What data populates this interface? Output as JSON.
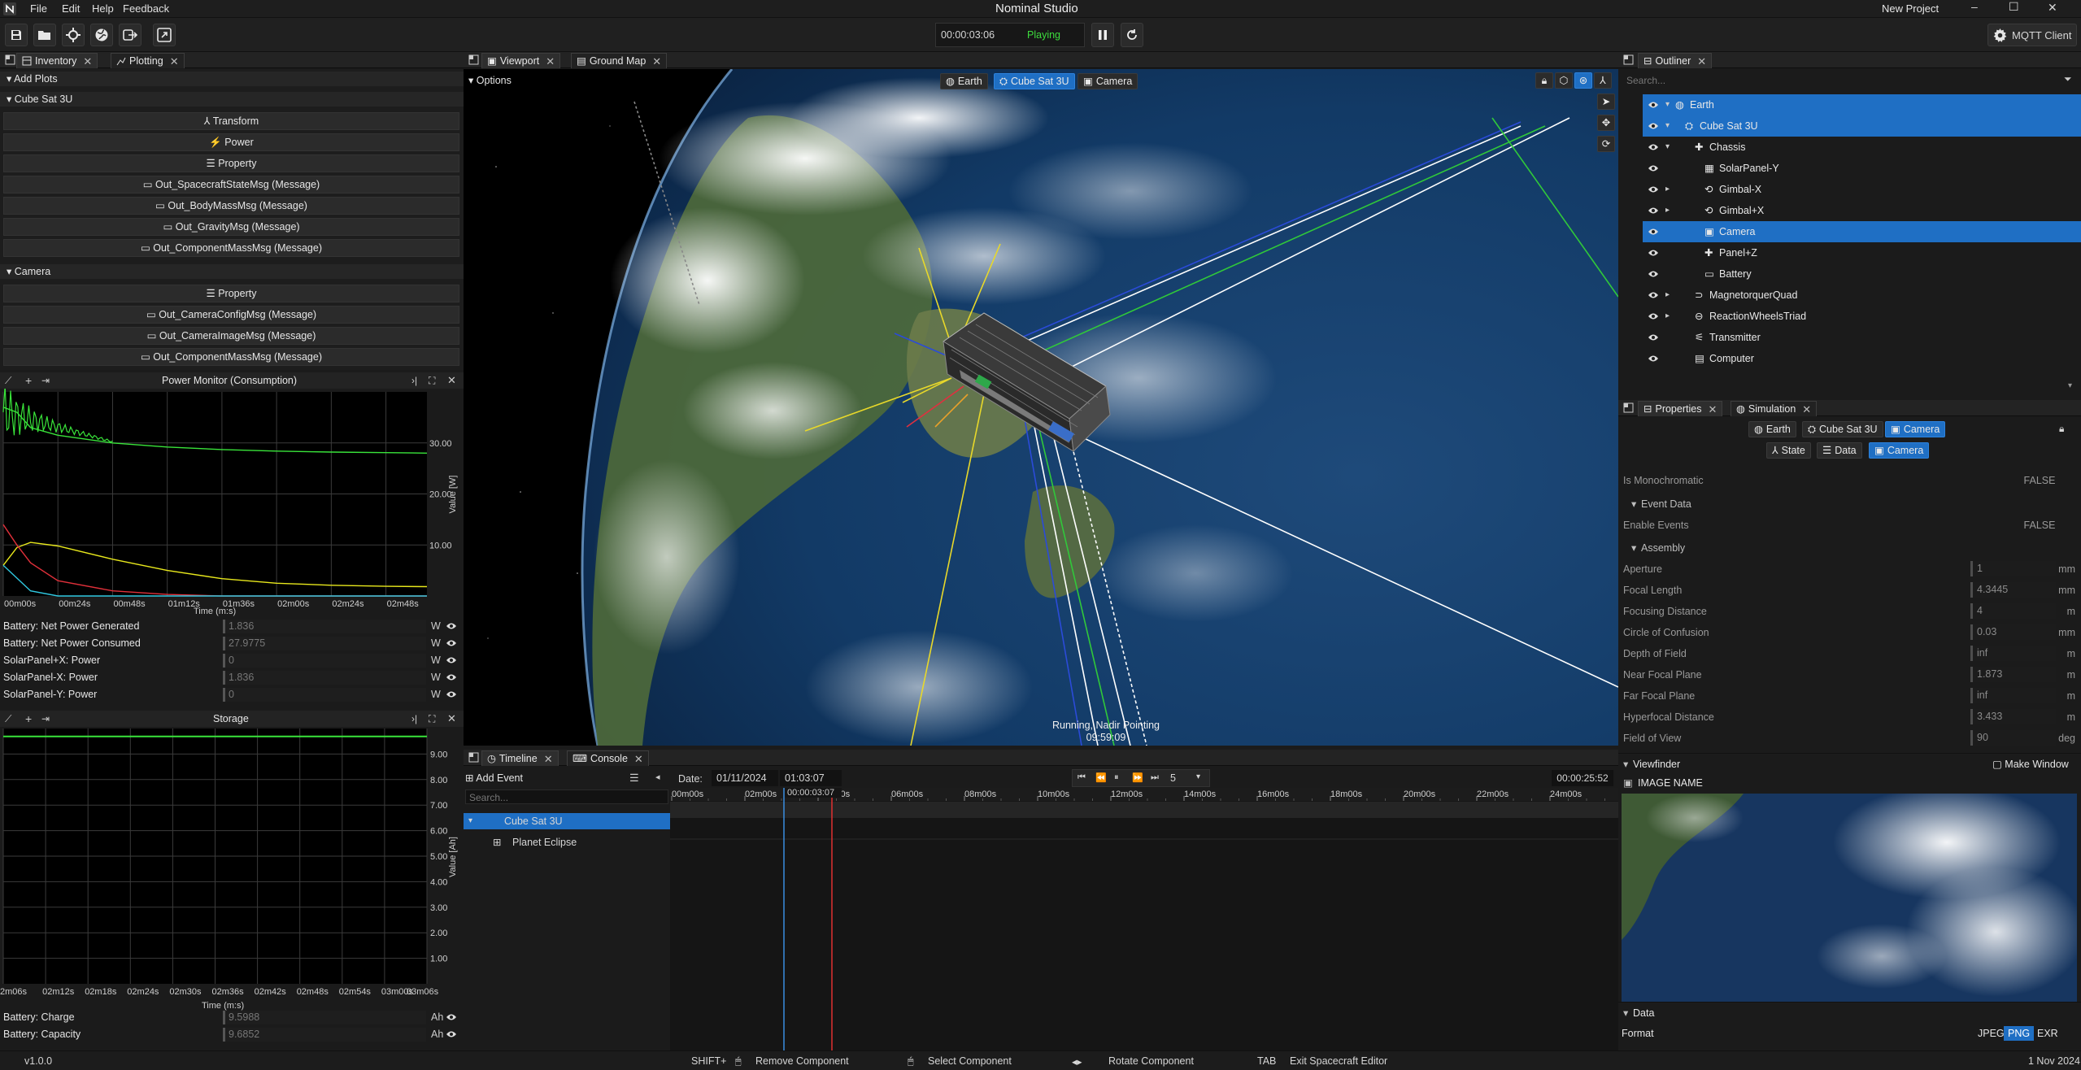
{
  "app": {
    "title": "Nominal Studio",
    "project": "New Project",
    "menu": [
      "File",
      "Edit",
      "Help",
      "Feedback"
    ],
    "window_controls": [
      "–",
      "☐",
      "✕"
    ]
  },
  "toolbar": {
    "time": "00:00:03:06",
    "status": "Playing",
    "mqtt_label": "MQTT Client"
  },
  "left_panel": {
    "tabs": [
      "Inventory",
      "Plotting"
    ],
    "add_plots": "Add Plots",
    "groups": [
      {
        "name": "Cube Sat 3U",
        "items": [
          "Transform",
          "Power",
          "Property",
          "Out_SpacecraftStateMsg (Message)",
          "Out_BodyMassMsg (Message)",
          "Out_GravityMsg (Message)",
          "Out_ComponentMassMsg (Message)"
        ]
      },
      {
        "name": "Camera",
        "items": [
          "Property",
          "Out_CameraConfigMsg (Message)",
          "Out_CameraImageMsg (Message)",
          "Out_ComponentMassMsg (Message)"
        ]
      }
    ]
  },
  "power_plot": {
    "title": "Power Monitor (Consumption)",
    "xlabel": "Time (m:s)",
    "ylabel": "Value [W]",
    "x_ticks": [
      "00m00s",
      "00m24s",
      "00m48s",
      "01m12s",
      "01m36s",
      "02m00s",
      "02m24s",
      "02m48s"
    ],
    "y_ticks": [
      "30.00",
      "20.00",
      "10.00"
    ],
    "rows": [
      {
        "label": "Battery: Net Power Generated",
        "value": "1.836",
        "unit": "W"
      },
      {
        "label": "Battery: Net Power Consumed",
        "value": "27.9775",
        "unit": "W"
      },
      {
        "label": "SolarPanel+X: Power",
        "value": "0",
        "unit": "W"
      },
      {
        "label": "SolarPanel-X: Power",
        "value": "1.836",
        "unit": "W"
      },
      {
        "label": "SolarPanel-Y: Power",
        "value": "0",
        "unit": "W"
      }
    ]
  },
  "storage_plot": {
    "title": "Storage",
    "xlabel": "Time (m:s)",
    "ylabel": "Value [Ah]",
    "x_ticks": [
      "2m06s",
      "02m12s",
      "02m18s",
      "02m24s",
      "02m30s",
      "02m36s",
      "02m42s",
      "02m48s",
      "02m54s",
      "03m00s",
      "03m06s"
    ],
    "y_ticks": [
      "9.00",
      "8.00",
      "7.00",
      "6.00",
      "5.00",
      "4.00",
      "3.00",
      "2.00",
      "1.00"
    ],
    "rows": [
      {
        "label": "Battery: Charge",
        "value": "9.5988",
        "unit": "Ah"
      },
      {
        "label": "Battery: Capacity",
        "value": "9.6852",
        "unit": "Ah"
      }
    ]
  },
  "chart_data": [
    {
      "type": "line",
      "title": "Power Monitor (Consumption)",
      "xlabel": "Time (m:s)",
      "ylabel": "Value [W]",
      "x": [
        0,
        6,
        12,
        24,
        48,
        72,
        96,
        120,
        144,
        168,
        186
      ],
      "ylim": [
        0,
        40
      ],
      "series": [
        {
          "color": "#39e43a",
          "values": [
            37,
            36,
            33,
            31.5,
            30,
            29.2,
            28.7,
            28.4,
            28.2,
            28.1,
            28.0
          ]
        },
        {
          "color": "#e8e81c",
          "values": [
            6,
            9.5,
            10.5,
            9.8,
            7.2,
            5.0,
            3.4,
            2.5,
            2.1,
            1.9,
            1.84
          ]
        },
        {
          "color": "#e0303a",
          "values": [
            14,
            10,
            6.5,
            3,
            1,
            0.3,
            0,
            0,
            0,
            0,
            0
          ]
        },
        {
          "color": "#30c8e0",
          "values": [
            6,
            3.5,
            1,
            0,
            0,
            0,
            0,
            0,
            0,
            0,
            0
          ]
        }
      ]
    },
    {
      "type": "line",
      "title": "Storage",
      "xlabel": "Time (m:s)",
      "ylabel": "Value [Ah]",
      "ylim": [
        0,
        10
      ],
      "series": [
        {
          "color": "#39e43a",
          "values": [
            9.69,
            9.69
          ]
        }
      ]
    }
  ],
  "viewport": {
    "tabs": [
      "Viewport",
      "Ground Map"
    ],
    "options_label": "Options",
    "view_chips": [
      "Earth",
      "Cube Sat 3U",
      "Camera"
    ],
    "status_line1": "Running, Nadir Pointing",
    "status_line2": "09:59:09"
  },
  "bottom_panel": {
    "tabs": [
      "Timeline",
      "Console"
    ],
    "add_event": "Add Event",
    "date_label": "Date:",
    "date": "01/11/2024",
    "time": "01:03:07",
    "speed": "5",
    "duration": "00:00:25:52",
    "search_placeholder": "Search...",
    "cursor_time": "00:00:03:07",
    "ruler": [
      "00m00s",
      "02m00s",
      "04m00s",
      "06m00s",
      "08m00s",
      "10m00s",
      "12m00s",
      "14m00s",
      "16m00s",
      "18m00s",
      "20m00s",
      "22m00s",
      "24m00s"
    ],
    "tracks": [
      "Cube Sat 3U",
      "Planet Eclipse"
    ]
  },
  "outliner": {
    "tab": "Outliner",
    "search_placeholder": "Search...",
    "items": [
      {
        "label": "Earth",
        "depth": 0,
        "expander": "▾",
        "icon": "globe-icon",
        "selected": true
      },
      {
        "label": "Cube Sat 3U",
        "depth": 1,
        "expander": "▾",
        "icon": "satellite-icon",
        "selected": true
      },
      {
        "label": "Chassis",
        "depth": 2,
        "expander": "▾",
        "icon": "puzzle-icon",
        "selected": false
      },
      {
        "label": "SolarPanel-Y",
        "depth": 3,
        "expander": "",
        "icon": "solar-panel-icon",
        "selected": false
      },
      {
        "label": "Gimbal-X",
        "depth": 3,
        "expander": "▸",
        "icon": "gimbal-icon",
        "selected": false
      },
      {
        "label": "Gimbal+X",
        "depth": 3,
        "expander": "▸",
        "icon": "gimbal-icon",
        "selected": false
      },
      {
        "label": "Camera",
        "depth": 3,
        "expander": "",
        "icon": "camera-icon",
        "selected": true
      },
      {
        "label": "Panel+Z",
        "depth": 3,
        "expander": "",
        "icon": "puzzle-icon",
        "selected": false
      },
      {
        "label": "Battery",
        "depth": 3,
        "expander": "",
        "icon": "battery-icon",
        "selected": false
      },
      {
        "label": "MagnetorquerQuad",
        "depth": 2,
        "expander": "▸",
        "icon": "magnet-icon",
        "selected": false
      },
      {
        "label": "ReactionWheelsTriad",
        "depth": 2,
        "expander": "▸",
        "icon": "wheel-icon",
        "selected": false
      },
      {
        "label": "Transmitter",
        "depth": 2,
        "expander": "",
        "icon": "antenna-icon",
        "selected": false
      },
      {
        "label": "Computer",
        "depth": 2,
        "expander": "",
        "icon": "chip-icon",
        "selected": false
      }
    ]
  },
  "properties": {
    "tabs": [
      "Properties",
      "Simulation"
    ],
    "chips_row1": [
      "Earth",
      "Cube Sat 3U",
      "Camera"
    ],
    "chips_row2": [
      "State",
      "Data",
      "Camera"
    ],
    "fields_top": [
      {
        "label": "Is Monochromatic",
        "value": "FALSE",
        "kind": "flag"
      }
    ],
    "event_data_header": "Event Data",
    "event_fields": [
      {
        "label": "Enable Events",
        "value": "FALSE",
        "kind": "flag"
      }
    ],
    "assembly_header": "Assembly",
    "assembly_fields": [
      {
        "label": "Aperture",
        "value": "1",
        "unit": "mm"
      },
      {
        "label": "Focal Length",
        "value": "4.3445",
        "unit": "mm"
      },
      {
        "label": "Focusing Distance",
        "value": "4",
        "unit": "m"
      },
      {
        "label": "Circle of Confusion",
        "value": "0.03",
        "unit": "mm"
      },
      {
        "label": "Depth of Field",
        "value": "inf",
        "unit": "m"
      },
      {
        "label": "Near Focal Plane",
        "value": "1.873",
        "unit": "m"
      },
      {
        "label": "Far Focal Plane",
        "value": "inf",
        "unit": "m"
      },
      {
        "label": "Hyperfocal Distance",
        "value": "3.433",
        "unit": "m"
      },
      {
        "label": "Field of View",
        "value": "90",
        "unit": "deg"
      }
    ],
    "viewfinder_header": "Viewfinder",
    "make_window": "Make Window",
    "image_name": "IMAGE NAME",
    "data_header": "Data",
    "format_label": "Format",
    "formats": [
      "JPEG",
      "PNG",
      "EXR"
    ],
    "active_format": "PNG"
  },
  "statusbar": {
    "version": "v1.0.0",
    "hints": [
      {
        "key": "SHIFT+",
        "action": "Remove Component"
      },
      {
        "key": "",
        "action": "Select Component"
      },
      {
        "key": "",
        "action": "Rotate Component"
      },
      {
        "key": "TAB",
        "action": "Exit Spacecraft Editor"
      }
    ],
    "date": "1 Nov 2024"
  },
  "colors": {
    "accent": "#1f6fc4",
    "playing": "#3ddc3d",
    "panel_bg": "#1b1b1b"
  }
}
